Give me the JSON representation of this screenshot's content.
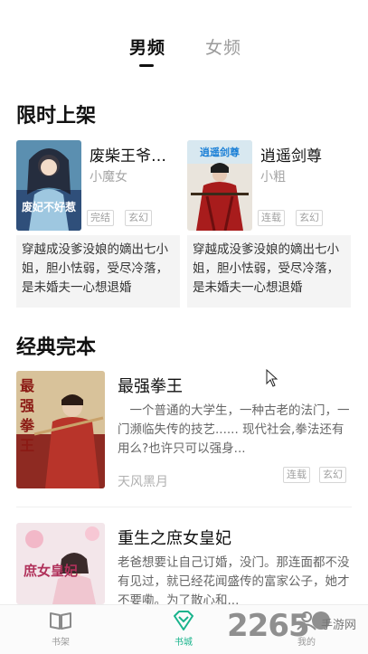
{
  "tabs": {
    "male": "男频",
    "female": "女频"
  },
  "sections": {
    "limited": "限时上架",
    "classic": "经典完本"
  },
  "limited_books": [
    {
      "title": "废柴王爷…",
      "author": "小魔女",
      "tag1": "完结",
      "tag2": "玄幻",
      "desc": "穿越成没爹没娘的嫡出七小姐，胆小怯弱，受尽冷落，是未婚夫一心想退婚",
      "cover_text": "废妃不好惹"
    },
    {
      "title": "逍遥剑尊",
      "author": "小粗",
      "tag1": "连载",
      "tag2": "玄幻",
      "desc": "穿越成没爹没娘的嫡出七小姐，胆小怯弱，受尽冷落，是未婚夫一心想退婚",
      "cover_text": "逍遥剑尊"
    }
  ],
  "classic_books": [
    {
      "title": "最强拳王",
      "desc": "　一个普通的大学生，一种古老的法门，一门濒临失传的技艺...... 现代社会,拳法还有用么?也许只可以强身...",
      "author": "天风黑月",
      "tag1": "连载",
      "tag2": "玄幻",
      "cover_text": "最强拳王"
    },
    {
      "title": "重生之庶女皇妃",
      "desc": "老爸想要让自己订婚，没门。那连面都不没有见过，就已经花闻盛传的富家公子，她才不要嘞。为了散心和...",
      "cover_text": "庶女皇妃"
    }
  ],
  "tabbar": {
    "shelf": "书架",
    "store": "书城",
    "mine": "我的"
  },
  "watermark": {
    "main": "2265",
    "sub": "手游网"
  },
  "colors": {
    "accent": "#19b38c"
  }
}
